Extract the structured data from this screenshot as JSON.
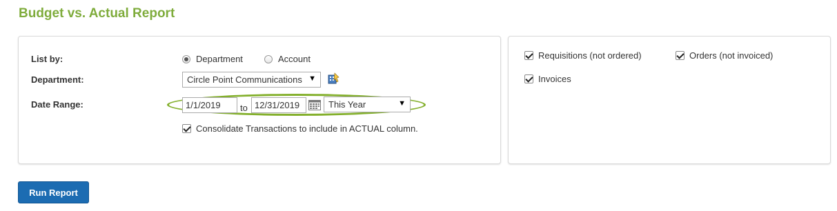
{
  "page": {
    "title": "Budget vs. Actual Report"
  },
  "form": {
    "list_by": {
      "label": "List by:",
      "options": [
        {
          "label": "Department",
          "selected": true
        },
        {
          "label": "Account",
          "selected": false
        }
      ]
    },
    "department": {
      "label": "Department:",
      "value": "Circle Point Communications",
      "icon": "department-lookup-icon"
    },
    "date_range": {
      "label": "Date Range:",
      "from": "1/1/2019",
      "to_text": "to",
      "to": "12/31/2019",
      "preset": "This Year",
      "icon": "calendar-icon"
    },
    "consolidate": {
      "label": "Consolidate Transactions to include in ACTUAL column.",
      "checked": true
    }
  },
  "options": {
    "requisitions": {
      "label": "Requisitions (not ordered)",
      "checked": true
    },
    "orders": {
      "label": "Orders (not invoiced)",
      "checked": true
    },
    "invoices": {
      "label": "Invoices",
      "checked": true
    }
  },
  "actions": {
    "run_report": "Run Report"
  },
  "colors": {
    "title": "#7fac3c",
    "highlight": "#84b02d",
    "primary_button": "#1c6cb2"
  }
}
